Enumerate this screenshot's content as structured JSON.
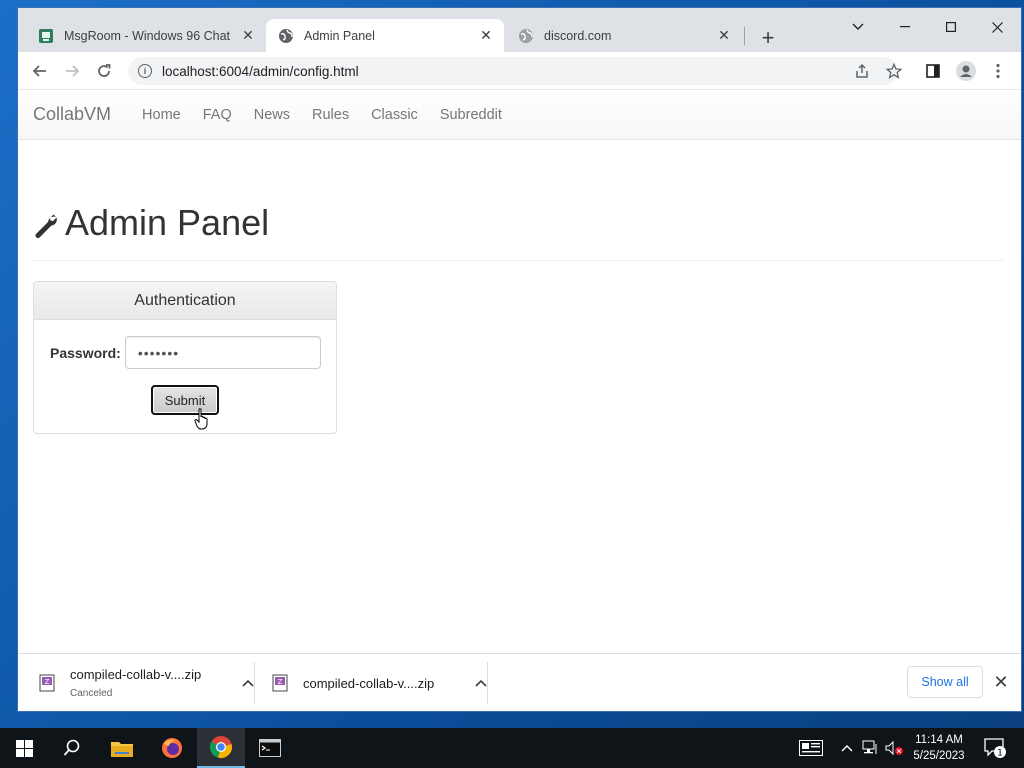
{
  "browser": {
    "tabs": [
      {
        "title": "MsgRoom - Windows 96 Chat",
        "favicon": "msgroom-icon",
        "active": false
      },
      {
        "title": "Admin Panel",
        "favicon": "globe-icon",
        "active": true
      },
      {
        "title": "discord.com",
        "favicon": "globe-icon",
        "active": false
      }
    ],
    "url": "localhost:6004/admin/config.html"
  },
  "page": {
    "navbar": {
      "brand": "CollabVM",
      "links": [
        "Home",
        "FAQ",
        "News",
        "Rules",
        "Classic",
        "Subreddit"
      ]
    },
    "heading": "Admin Panel",
    "auth_panel": {
      "title": "Authentication",
      "password_label": "Password:",
      "password_value": "•••••••",
      "submit_label": "Submit"
    }
  },
  "downloads": {
    "items": [
      {
        "name": "compiled-collab-v....zip",
        "status": "Canceled"
      },
      {
        "name": "compiled-collab-v....zip",
        "status": ""
      }
    ],
    "show_all_label": "Show all"
  },
  "taskbar": {
    "time": "11:14 AM",
    "date": "5/25/2023",
    "notification_count": "1",
    "accent": "#76b9ed"
  }
}
